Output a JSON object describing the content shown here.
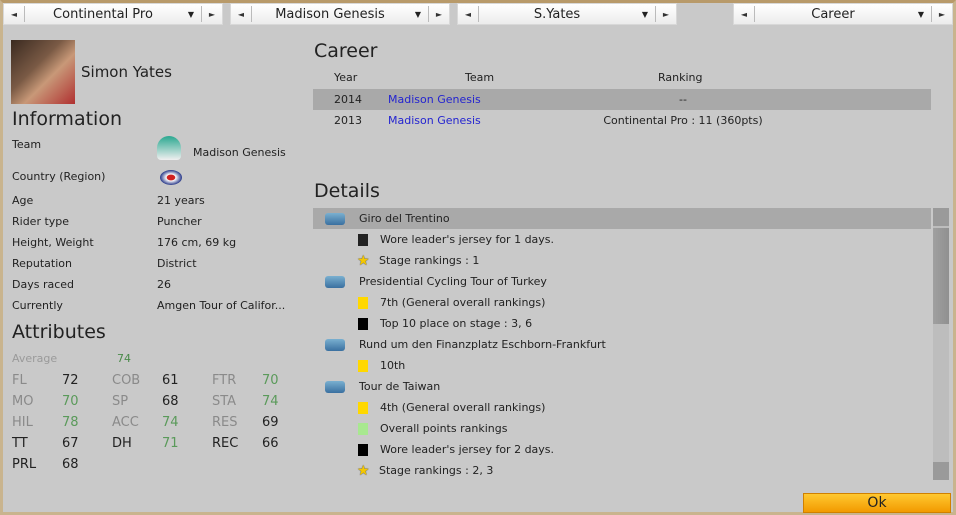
{
  "top_bar": {
    "dropdowns": [
      {
        "value": "Continental Pro"
      },
      {
        "value": "Madison Genesis"
      },
      {
        "value": "S.Yates"
      },
      {
        "value": "Career"
      }
    ]
  },
  "rider": {
    "name": "Simon Yates"
  },
  "information": {
    "title": "Information",
    "rows": [
      {
        "label": "Team",
        "value": "Madison Genesis"
      },
      {
        "label": "Country (Region)",
        "value": ""
      },
      {
        "label": "Age",
        "value": "21 years"
      },
      {
        "label": "Rider type",
        "value": "Puncher"
      },
      {
        "label": "Height, Weight",
        "value": "176 cm, 69 kg"
      },
      {
        "label": "Reputation",
        "value": "District"
      },
      {
        "label": "Days raced",
        "value": "26"
      },
      {
        "label": "Currently",
        "value": "Amgen Tour of Califor..."
      }
    ]
  },
  "attributes": {
    "title": "Attributes",
    "average_label": "Average",
    "average": "74",
    "items": [
      {
        "k": "FL",
        "v": "72"
      },
      {
        "k": "COB",
        "v": "61"
      },
      {
        "k": "FTR",
        "v": "70"
      },
      {
        "k": "MO",
        "v": "70"
      },
      {
        "k": "SP",
        "v": "68"
      },
      {
        "k": "STA",
        "v": "74"
      },
      {
        "k": "HIL",
        "v": "78"
      },
      {
        "k": "ACC",
        "v": "74"
      },
      {
        "k": "RES",
        "v": "69"
      },
      {
        "k": "TT",
        "v": "67"
      },
      {
        "k": "DH",
        "v": "71"
      },
      {
        "k": "REC",
        "v": "66"
      },
      {
        "k": "PRL",
        "v": "68"
      }
    ]
  },
  "career": {
    "title": "Career",
    "headers": {
      "year": "Year",
      "team": "Team",
      "ranking": "Ranking"
    },
    "rows": [
      {
        "year": "2014",
        "team": "Madison Genesis",
        "ranking": "--"
      },
      {
        "year": "2013",
        "team": "Madison Genesis",
        "ranking": "Continental Pro : 11 (360pts)"
      }
    ]
  },
  "details": {
    "title": "Details",
    "items": [
      {
        "type": "race",
        "text": "Giro del Trentino"
      },
      {
        "type": "jersey",
        "text": "Wore leader's jersey for 1 days."
      },
      {
        "type": "star",
        "text": "Stage rankings : 1"
      },
      {
        "type": "race",
        "text": "Presidential Cycling Tour of Turkey"
      },
      {
        "type": "yellow",
        "text": "7th (General overall rankings)"
      },
      {
        "type": "black",
        "text": "Top 10 place on stage : 3, 6"
      },
      {
        "type": "race",
        "text": "Rund um den Finanzplatz Eschborn-Frankfurt"
      },
      {
        "type": "yellow",
        "text": "10th"
      },
      {
        "type": "race",
        "text": "Tour de Taiwan"
      },
      {
        "type": "yellow",
        "text": "4th (General overall rankings)"
      },
      {
        "type": "green",
        "text": "Overall points rankings"
      },
      {
        "type": "black",
        "text": "Wore leader's jersey for 2 days."
      },
      {
        "type": "star",
        "text": "Stage rankings : 2, 3"
      }
    ]
  },
  "ok_label": "Ok",
  "colors": {
    "accent": "#f5a300",
    "link": "#2424d0",
    "yellow": "#ffd800",
    "green": "#a8e890",
    "highlight_row": "#a9a9a9"
  }
}
